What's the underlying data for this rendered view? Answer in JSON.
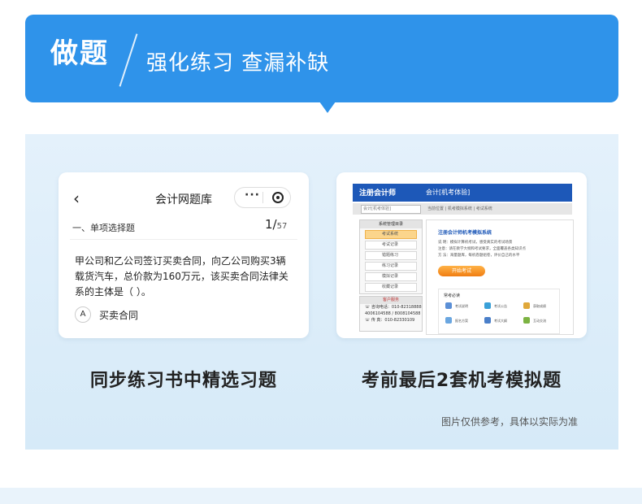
{
  "banner": {
    "title": "做题",
    "subtitle": "强化练习 查漏补缺"
  },
  "left_card": {
    "back_icon": "chevron-left-icon",
    "nav_title": "会计网题库",
    "capsule_more": "···",
    "section_label": "一、单项选择题",
    "counter_current": "1/",
    "counter_total": "57",
    "question": "甲公司和乙公司签订买卖合同，向乙公司购买3辆载货汽车，总价款为160万元，该买卖合同法律关系的主体是（ ）。",
    "option_letter": "A",
    "option_text": "买卖合同"
  },
  "right_card": {
    "brand": "注册会计师",
    "title": "会计[机考体验]",
    "select_value": "会计[机考体验]",
    "crumb": "当前位置 | 机考模拟系统 | 考试系统",
    "side_head": "系统管理目录",
    "side_items": [
      "考试系统",
      "考试记录",
      "错题练习",
      "练习记录",
      "模拟记录",
      "收藏记录"
    ],
    "service_head": "客户服务",
    "service_lines": [
      "☏ 咨询电话：010-82318888",
      "4006104588 / 8008104588",
      "☏ 传 真：010-82330109"
    ],
    "main_title": "注册会计师机考模拟系统",
    "main_lines": [
      "说 明：模拟计算机考试，感受真实的考试场景",
      "注意：请在教学大纲和考试要求，全面覆盖各类知识点",
      "方 法：海量题库，每机卷题组卷，评价自己的水平"
    ],
    "start_label": "开始考试",
    "box_title": "常考必读",
    "box_items": [
      "考试说明",
      "考试公告",
      "获取成绩",
      "报名方案",
      "考试大纲",
      "互动交流"
    ]
  },
  "captions": {
    "left": "同步练习书中精选习题",
    "right": "考前最后2套机考模拟题"
  },
  "disclaimer": "图片仅供参考，具体以实际为准",
  "colors": {
    "banner": "#2f93ea",
    "panel": "#dcedf9",
    "system_header": "#1d58b8",
    "start_button": "#f07d12"
  }
}
